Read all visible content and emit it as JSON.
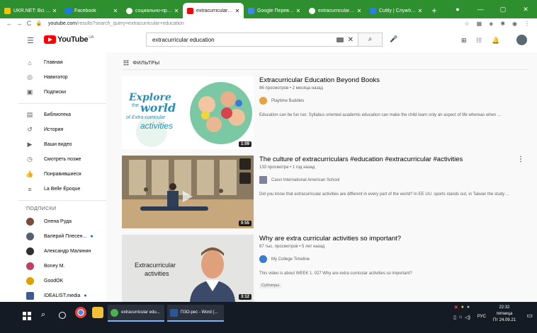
{
  "browser": {
    "tabs": [
      {
        "label": "UKR.NET: Всі новини",
        "color": "#f5c400",
        "active": false
      },
      {
        "label": "Facebook",
        "color": "#1877f2",
        "active": false
      },
      {
        "label": "социально-проводи",
        "color": "#ffffff",
        "active": false
      },
      {
        "label": "extracurricular edu",
        "color": "#ff0000",
        "active": true
      },
      {
        "label": "Google Переводчик",
        "color": "#4285f4",
        "active": false
      },
      {
        "label": "extracurricular edu",
        "color": "#ffffff",
        "active": false
      },
      {
        "label": "Cuttly | Служба ск",
        "color": "#2b7de9",
        "active": false
      }
    ],
    "new_tab": "+",
    "url_host": "youtube.com",
    "url_path": "/results?search_query=extracurricular+education"
  },
  "youtube": {
    "logo_text": "YouTube",
    "region": "UA",
    "search_value": "extracurricular education",
    "sidebar": {
      "main": [
        {
          "icon": "home-icon",
          "glyph": "⌂",
          "label": "Главная"
        },
        {
          "icon": "compass-icon",
          "glyph": "◎",
          "label": "Навигатор"
        },
        {
          "icon": "subscriptions-icon",
          "glyph": "▣",
          "label": "Подписки"
        }
      ],
      "library": [
        {
          "icon": "library-icon",
          "glyph": "▤",
          "label": "Библиотека"
        },
        {
          "icon": "history-icon",
          "glyph": "↺",
          "label": "История"
        },
        {
          "icon": "your-videos-icon",
          "glyph": "▶",
          "label": "Ваши видео"
        },
        {
          "icon": "watch-later-icon",
          "glyph": "◷",
          "label": "Смотреть позже"
        },
        {
          "icon": "liked-icon",
          "glyph": "👍",
          "label": "Понравившиеся"
        },
        {
          "icon": "playlist-icon",
          "glyph": "≡",
          "label": "La Belle Époque"
        }
      ],
      "subscriptions_heading": "ПОДПИСКИ",
      "subscriptions": [
        {
          "label": "Олена Руда",
          "color": "#7a4a3a",
          "new": false
        },
        {
          "label": "Валерий Плесен...",
          "color": "#556070",
          "new": true
        },
        {
          "label": "Александр Малинин",
          "color": "#303030",
          "new": false
        },
        {
          "label": "Boney M.",
          "color": "#c04060",
          "new": false
        },
        {
          "label": "GoodOK",
          "color": "#e0a000",
          "new": false
        },
        {
          "label": "IDEALIST.media",
          "color": "#3a5a9a",
          "new": true
        }
      ]
    },
    "filters_label": "ФИЛЬТРЫ",
    "results": [
      {
        "title": "Extracurricular Education Beyond Books",
        "meta": "86 просмотров • 2 месяца назад",
        "channel": "Playtime Buddies",
        "channel_color": "#e8a040",
        "description": "Education can be fun too: Syllabus oriented academic education can make the child learn only an aspect of life whereas when ...",
        "duration": "1:09",
        "thumb_line1": "Explore",
        "thumb_line2": "the",
        "thumb_line3": "world",
        "thumb_line4": "of Extra-curricular",
        "thumb_line5": "activities"
      },
      {
        "title": "The culture of extracurriculars #education #extracurricular #activities",
        "meta": "133 просмотра • 1 год назад",
        "channel": "Casvi International American School",
        "channel_color": "#8080a0",
        "description": "Did you know that extracurricular activities are different in every part of the world? In EE UU. sports stands out, in Taiwan the study ...",
        "duration": "0:55"
      },
      {
        "title": "Why are extra curricular activities so important?",
        "meta": "67 тыс. просмотров • 5 лет назад",
        "channel": "My College Timeline",
        "channel_color": "#3a7ad0",
        "description": "This video is about WEEK 1. 027 Why are extra curricular activities so important?",
        "badge": "Субтитры",
        "duration": "3:12",
        "thumb_text1": "Extracurricular",
        "thumb_text2": "activities"
      }
    ]
  },
  "taskbar": {
    "apps": [
      {
        "label": "extracurricular edu...",
        "color": "#4caf50"
      },
      {
        "label": "ПЗО-рес - Word (...",
        "color": "#2b579a"
      }
    ],
    "lang": "РУС",
    "time": "22:32",
    "day": "пятница",
    "date": "Пт 24.09.21"
  }
}
